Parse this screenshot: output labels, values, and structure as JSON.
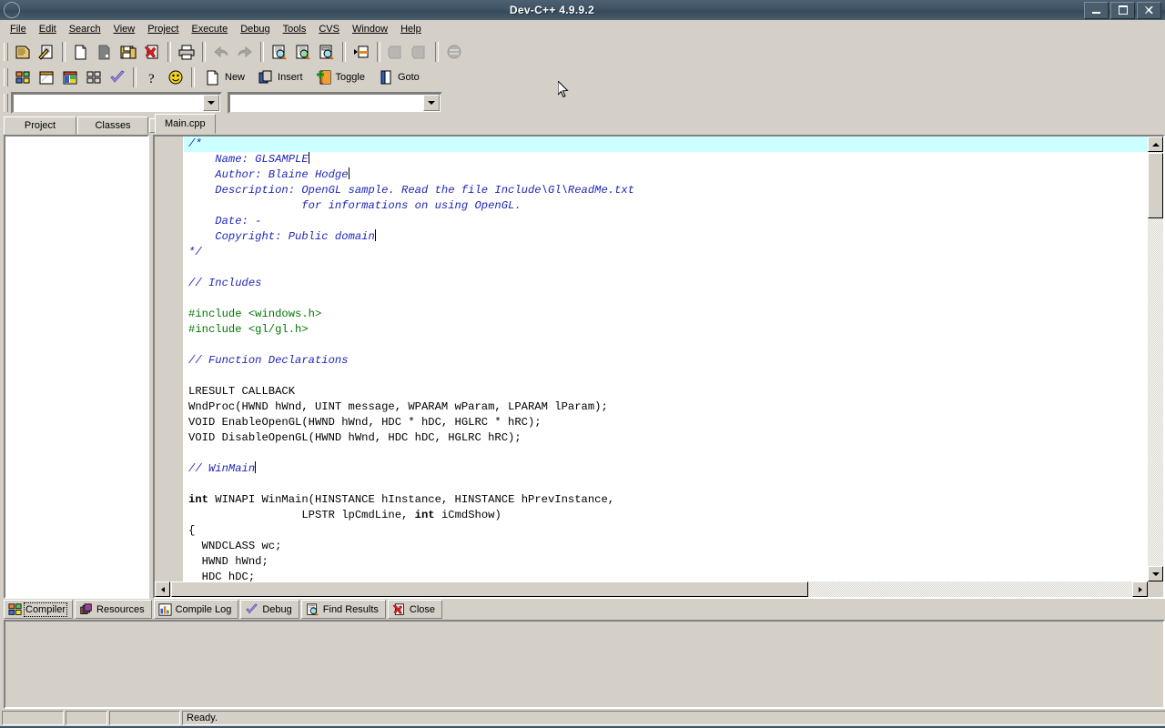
{
  "window": {
    "title": "Dev-C++ 4.9.9.2",
    "sysicon": "app-icon",
    "minimize": "–",
    "maximize": "□",
    "close": "✕"
  },
  "menubar": {
    "items": [
      {
        "label": "File",
        "accel": "F"
      },
      {
        "label": "Edit",
        "accel": "E"
      },
      {
        "label": "Search",
        "accel": "S"
      },
      {
        "label": "View",
        "accel": "V"
      },
      {
        "label": "Project",
        "accel": "P"
      },
      {
        "label": "Execute",
        "accel": "x"
      },
      {
        "label": "Debug",
        "accel": "D"
      },
      {
        "label": "Tools",
        "accel": "T"
      },
      {
        "label": "CVS",
        "accel": "C"
      },
      {
        "label": "Window",
        "accel": "W"
      },
      {
        "label": "Help",
        "accel": "H"
      }
    ]
  },
  "toolbar_row1": {
    "buttons": [
      {
        "name": "new-project-icon",
        "title": "New project"
      },
      {
        "name": "open-project-icon",
        "title": "Open project"
      },
      {
        "name": "new-file-icon",
        "title": "New source file"
      },
      {
        "name": "open-file-icon",
        "title": "Open file"
      },
      {
        "name": "save-icon",
        "title": "Save"
      },
      {
        "name": "close-file-icon",
        "title": "Close"
      },
      {
        "name": "print-icon",
        "title": "Print"
      },
      {
        "name": "undo-icon",
        "title": "Undo"
      },
      {
        "name": "redo-icon",
        "title": "Redo"
      },
      {
        "name": "find-icon",
        "title": "Find"
      },
      {
        "name": "find-next-icon",
        "title": "Find next"
      },
      {
        "name": "replace-icon",
        "title": "Replace"
      },
      {
        "name": "goto-line-icon",
        "title": "Goto line"
      },
      {
        "name": "compile-icon",
        "title": "Compile"
      },
      {
        "name": "run-icon",
        "title": "Run"
      },
      {
        "name": "compile-run-icon",
        "title": "Compile and run"
      }
    ]
  },
  "toolbar_row2": {
    "buttons": [
      {
        "name": "project-manager-icon",
        "title": "Project manager"
      },
      {
        "name": "window-icon",
        "title": "Window"
      },
      {
        "name": "class-browser-icon",
        "title": "Class browser"
      },
      {
        "name": "tile-icon",
        "title": "Tile"
      },
      {
        "name": "check-icon",
        "title": "Syntax check"
      },
      {
        "name": "help-icon",
        "title": "Help"
      },
      {
        "name": "about-icon",
        "title": "About"
      }
    ],
    "text_buttons": [
      {
        "name": "new-bookmark-button",
        "label": "New",
        "icon": "page-icon"
      },
      {
        "name": "insert-button",
        "label": "Insert",
        "icon": "insert-icon"
      },
      {
        "name": "toggle-button",
        "label": "Toggle",
        "icon": "toggle-icon"
      },
      {
        "name": "goto-button",
        "label": "Goto",
        "icon": "goto-icon"
      }
    ]
  },
  "toolbar_row3": {
    "combo_left": {
      "value": "",
      "placeholder": ""
    },
    "combo_right": {
      "value": "",
      "placeholder": ""
    }
  },
  "left_panel": {
    "tabs": [
      {
        "label": "Project",
        "selected": false
      },
      {
        "label": "Classes",
        "selected": true
      }
    ],
    "scroll_left": "◄",
    "scroll_right": "►",
    "content": ""
  },
  "editor": {
    "tabs": [
      {
        "label": "Main.cpp",
        "selected": true
      }
    ],
    "lines": [
      {
        "cur": true,
        "segs": [
          {
            "cls": "c-cmt",
            "t": "/*"
          }
        ]
      },
      {
        "cur": false,
        "segs": [
          {
            "cls": "c-cmt",
            "t": "    Name: GLSAMPLE"
          },
          {
            "cls": "caret",
            "t": ""
          }
        ]
      },
      {
        "cur": false,
        "segs": [
          {
            "cls": "c-cmt",
            "t": "    Author: Blaine Hodge"
          },
          {
            "cls": "caret",
            "t": ""
          }
        ]
      },
      {
        "cur": false,
        "segs": [
          {
            "cls": "c-cmt",
            "t": "    Description: OpenGL sample. Read the file Include\\Gl\\ReadMe.txt"
          }
        ]
      },
      {
        "cur": false,
        "segs": [
          {
            "cls": "c-cmt",
            "t": "                 for informations on using OpenGL."
          }
        ]
      },
      {
        "cur": false,
        "segs": [
          {
            "cls": "c-cmt",
            "t": "    Date: -"
          }
        ]
      },
      {
        "cur": false,
        "segs": [
          {
            "cls": "c-cmt",
            "t": "    Copyright: Public domain"
          },
          {
            "cls": "caret",
            "t": ""
          }
        ]
      },
      {
        "cur": false,
        "segs": [
          {
            "cls": "c-cmt",
            "t": "*/"
          }
        ]
      },
      {
        "cur": false,
        "segs": []
      },
      {
        "cur": false,
        "segs": [
          {
            "cls": "c-cmt",
            "t": "// Includes"
          }
        ]
      },
      {
        "cur": false,
        "segs": []
      },
      {
        "cur": false,
        "segs": [
          {
            "cls": "c-pre",
            "t": "#include <windows.h>"
          }
        ]
      },
      {
        "cur": false,
        "segs": [
          {
            "cls": "c-pre",
            "t": "#include <gl/gl.h>"
          }
        ]
      },
      {
        "cur": false,
        "segs": []
      },
      {
        "cur": false,
        "segs": [
          {
            "cls": "c-cmt",
            "t": "// Function Declarations"
          }
        ]
      },
      {
        "cur": false,
        "segs": []
      },
      {
        "cur": false,
        "segs": [
          {
            "cls": "c-txt",
            "t": "LRESULT CALLBACK"
          }
        ]
      },
      {
        "cur": false,
        "segs": [
          {
            "cls": "c-txt",
            "t": "WndProc(HWND hWnd, UINT message, WPARAM wParam, LPARAM lParam);"
          }
        ]
      },
      {
        "cur": false,
        "segs": [
          {
            "cls": "c-txt",
            "t": "VOID EnableOpenGL(HWND hWnd, HDC * hDC, HGLRC * hRC);"
          }
        ]
      },
      {
        "cur": false,
        "segs": [
          {
            "cls": "c-txt",
            "t": "VOID DisableOpenGL(HWND hWnd, HDC hDC, HGLRC hRC);"
          }
        ]
      },
      {
        "cur": false,
        "segs": []
      },
      {
        "cur": false,
        "segs": [
          {
            "cls": "c-cmt",
            "t": "// WinMain"
          },
          {
            "cls": "caret",
            "t": ""
          }
        ]
      },
      {
        "cur": false,
        "segs": []
      },
      {
        "cur": false,
        "segs": [
          {
            "cls": "c-kw",
            "t": "int"
          },
          {
            "cls": "c-txt",
            "t": " WINAPI WinMain(HINSTANCE hInstance, HINSTANCE hPrevInstance,"
          }
        ]
      },
      {
        "cur": false,
        "segs": [
          {
            "cls": "c-txt",
            "t": "                 LPSTR lpCmdLine, "
          },
          {
            "cls": "c-kw",
            "t": "int"
          },
          {
            "cls": "c-txt",
            "t": " iCmdShow)"
          }
        ]
      },
      {
        "cur": false,
        "segs": [
          {
            "cls": "c-txt",
            "t": "{"
          }
        ]
      },
      {
        "cur": false,
        "segs": [
          {
            "cls": "c-txt",
            "t": "  WNDCLASS wc;"
          }
        ]
      },
      {
        "cur": false,
        "segs": [
          {
            "cls": "c-txt",
            "t": "  HWND hWnd;"
          }
        ]
      },
      {
        "cur": false,
        "segs": [
          {
            "cls": "c-txt",
            "t": "  HDC hDC;"
          }
        ]
      }
    ]
  },
  "bottom_panel": {
    "tabs": [
      {
        "label": "Compiler",
        "icon": "compiler-icon",
        "selected": true
      },
      {
        "label": "Resources",
        "icon": "resources-icon",
        "selected": false
      },
      {
        "label": "Compile Log",
        "icon": "compile-log-icon",
        "selected": false
      },
      {
        "label": "Debug",
        "icon": "debug-check-icon",
        "selected": false
      },
      {
        "label": "Find Results",
        "icon": "find-results-icon",
        "selected": false
      },
      {
        "label": "Close",
        "icon": "close-red-icon",
        "selected": false
      }
    ],
    "content": ""
  },
  "statusbar": {
    "panes": [
      "",
      "",
      "",
      "Ready."
    ]
  },
  "colors": {
    "titlebar": "#3f5465",
    "face": "#d4d0c8",
    "comment": "#1f27b8",
    "preprocessor": "#007800",
    "current_line": "#ccffff",
    "editor_bg": "#ffffff"
  }
}
